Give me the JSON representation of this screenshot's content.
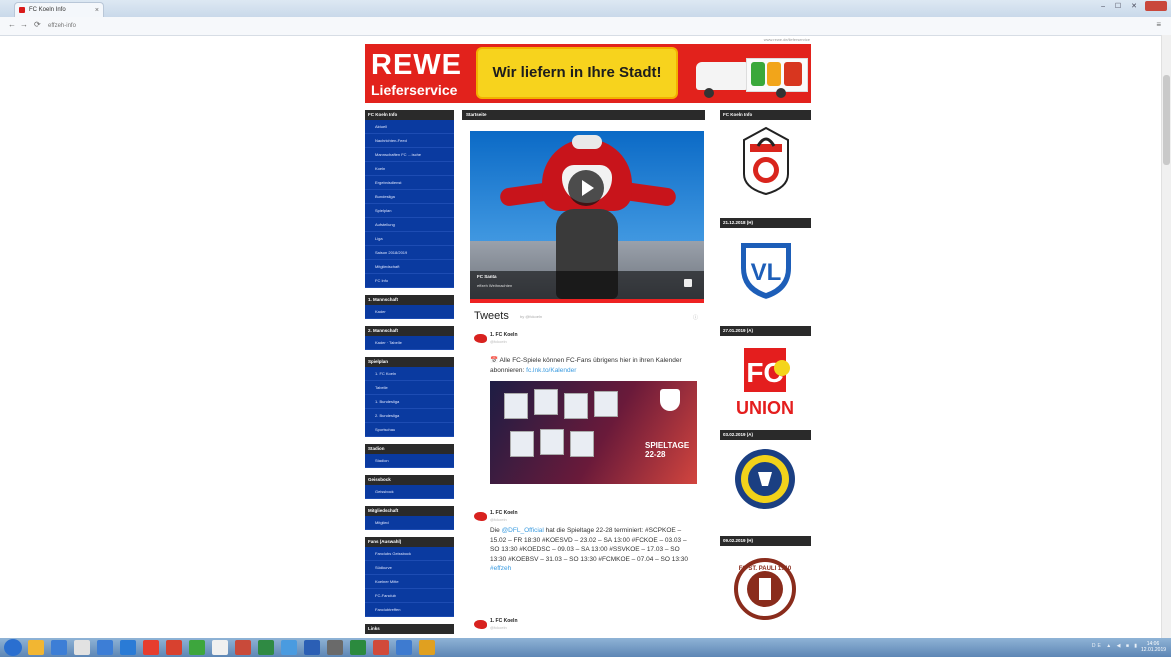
{
  "browser": {
    "tab_title": "FC Koeln Info",
    "address": "effzeh-info",
    "window_controls": "–  ☐  ✕",
    "back_icon": "back-icon",
    "forward_icon": "forward-icon",
    "reload_icon": "reload-icon",
    "menu_icon": "menu-icon"
  },
  "banner": {
    "top_small": "www.rewe.de/lieferservice",
    "brand": "REWE",
    "brand_sub": "Lieferservice",
    "slogan": "Wir liefern in Ihre Stadt!",
    "colors": {
      "red": "#e2221c",
      "yellow": "#f7d31d"
    }
  },
  "left_sidebar": {
    "boxes": [
      {
        "title": "FC Koeln Info",
        "items": [
          "Aktuell",
          "Nachrichten-Feed",
          "Mannschaften FC …ische",
          "Koeln",
          "Ergebnisdienst",
          "Bundesliga",
          "Spielplan",
          "Aufstellung",
          "Liga",
          "Saison 2018/2019",
          "Mitgliedschaft",
          "FC Info"
        ]
      },
      {
        "title": "1. Mannschaft",
        "items": [
          "Kader"
        ]
      },
      {
        "title": "2. Mannschaft",
        "items": [
          "Kader · Tabelle"
        ]
      },
      {
        "title": "Spielplan",
        "items": [
          "1. FC Koeln",
          "Tabelle",
          "1. Bundesliga",
          "2. Bundesliga",
          "Sportschau"
        ]
      },
      {
        "title": "Stadion",
        "items": [
          "Stadion"
        ]
      },
      {
        "title": "Geissbock",
        "items": [
          "Geissbock"
        ]
      },
      {
        "title": "Mitgliedschaft",
        "items": [
          "Mitglied"
        ]
      },
      {
        "title": "Fans (Auswahl)",
        "items": [
          "Fanclubs Geissbock",
          "Südkurve",
          "Koelner Mitte",
          "FC-Fanclub",
          "Fanclubtreffen"
        ]
      },
      {
        "title": "Links",
        "items": []
      }
    ]
  },
  "main": {
    "section_title": "Startseite",
    "video": {
      "title": "FC Santa",
      "subtitle": "effzeh Weihnachten",
      "play_icon": "play-icon"
    },
    "tweets": {
      "title": "Tweets",
      "by": "by @fckoeln",
      "info_icon": "info-icon",
      "items": [
        {
          "author": "1. FC Koeln",
          "handle": "@fckoeln",
          "text": "Alle FC-Spiele können FC-Fans übrigens hier in ihren Kalender abonnieren:",
          "link": "fc.lnk.to/Kalender",
          "image_caption": "SPIELTAGE 22-28"
        },
        {
          "author": "1. FC Koeln",
          "handle": "@fckoeln",
          "text_pre": "Die",
          "mention": "@DFL_Official",
          "text_mid": "hat die Spieltage 22-28 terminiert:",
          "schedule": "#SCPKOE – 15.02 – FR 18:30 #KOESVD – 23.02 – SA 13:00 #FCKOE – 03.03 – SO 13:30 #KOEDSC – 09.03 – SA 13:00 #SSVKOE – 17.03 – SO 13:30 #KOEBSV – 31.03 – SO 13:30 #FCMKOE – 07.04 – SO 13:30",
          "hashtag": "#effzeh"
        },
        {
          "author": "1. FC Koeln",
          "handle": "@fckoeln"
        }
      ]
    }
  },
  "right_sidebar": {
    "boxes": [
      {
        "title": "FC Koeln Info",
        "crest": "fc-koeln-crest"
      },
      {
        "title": "21.12.2018 (H)",
        "crest": "vfl-bochum-crest"
      },
      {
        "title": "27.01.2019 (A)",
        "crest": "union-berlin-crest",
        "crest_text_top": "FC",
        "crest_text": "UNION"
      },
      {
        "title": "03.02.2019 (A)",
        "crest": "erzgebirge-aue-crest"
      },
      {
        "title": "09.02.2019 (H)",
        "crest": "st-pauli-crest",
        "crest_text": "FC ST. PAULI 1910"
      }
    ]
  },
  "taskbar": {
    "clock_time": "14:06",
    "clock_date": "12.01.2019",
    "tray": "DE ▲ ◀ ■ ▮"
  }
}
